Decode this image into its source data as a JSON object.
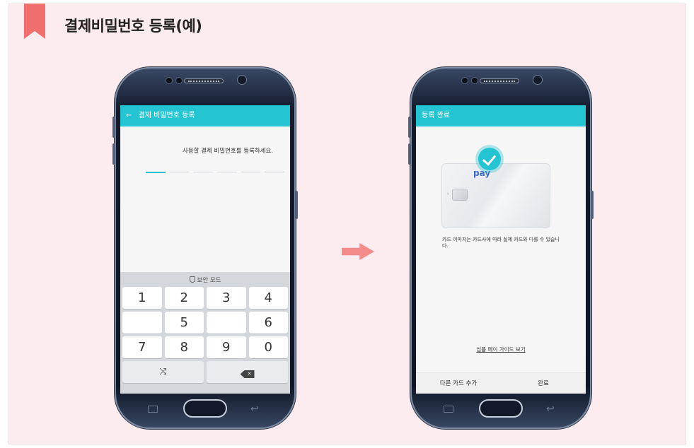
{
  "header": {
    "title": "결제비밀번호 등록(예)",
    "accent_color": "#ef6f6f"
  },
  "screens": {
    "register": {
      "appbar_back": "←",
      "appbar_title": "결제 비밀번호 등록",
      "prompt": "사용할 결제 비밀번호를 등록하세요.",
      "pin_length": 6,
      "keypad": {
        "secure_mode_label": "보안 모드",
        "row1": [
          "1",
          "2",
          "3",
          "4"
        ],
        "row2": [
          "",
          "5",
          "",
          "6"
        ],
        "row3": [
          "7",
          "8",
          "9",
          "0"
        ],
        "shuffle_icon": "shuffle-icon",
        "backspace_icon": "backspace-icon",
        "backspace_glyph": "✕"
      }
    },
    "complete": {
      "appbar_title": "등록 완료",
      "card_brand": "pay",
      "notice": "카드 이미지는 카드사에 따라 실제 카드와 다를 수 있습니다.",
      "guide_link": "심플 페이 가이드 보기",
      "add_card_button": "다른 카드 추가",
      "done_button": "완료"
    }
  },
  "colors": {
    "appbar": "#25c4d3",
    "panel_bg": "#fdecef",
    "flow_arrow": "#f38b8b"
  }
}
